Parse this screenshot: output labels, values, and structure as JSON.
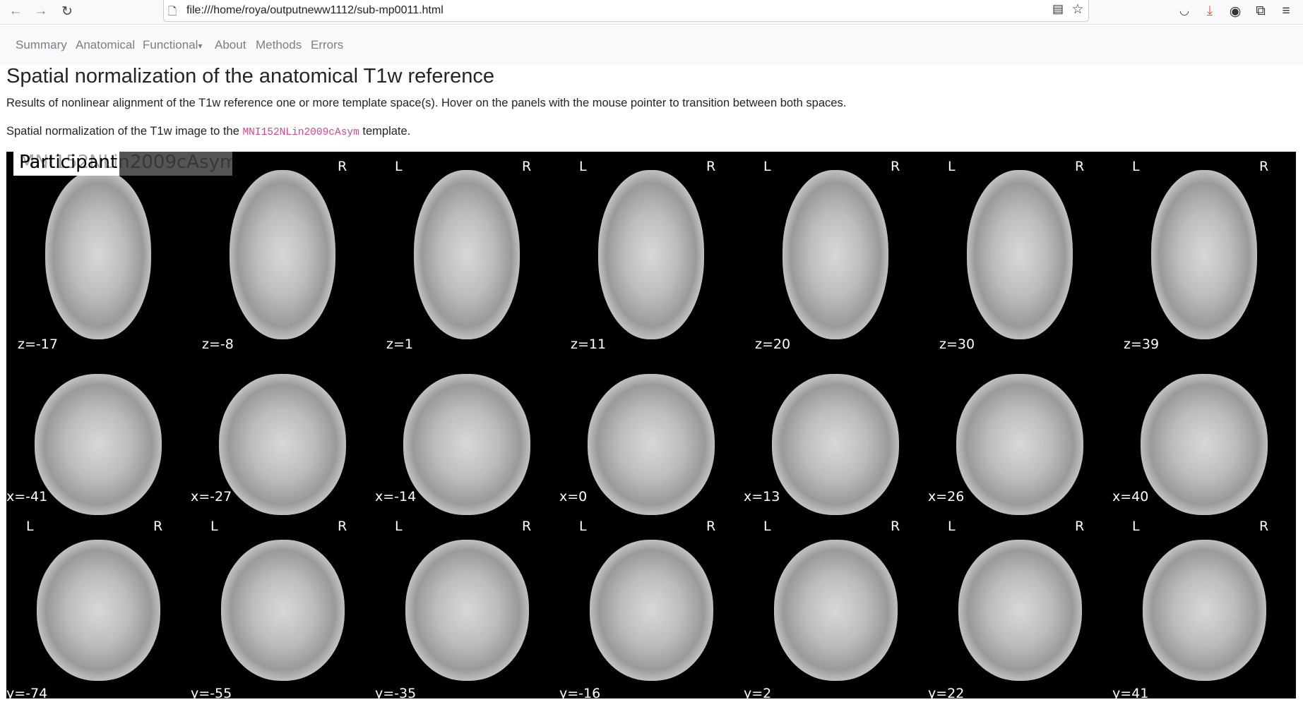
{
  "browser": {
    "url": "file:///home/roya/outputneww1112/sub-mp0011.html",
    "accent": "#e8572b"
  },
  "nav": {
    "items": [
      "Summary",
      "Anatomical",
      "Functional",
      "About",
      "Methods",
      "Errors"
    ],
    "dropdown_caret": "▾"
  },
  "title": "Spatial normalization of the anatomical T1w reference",
  "description": "Results of nonlinear alignment of the T1w reference one or more template space(s). Hover on the panels with the mouse pointer to transition between both spaces.",
  "caption": {
    "prefix": "Spatial normalization of the T1w image to the ",
    "template": "MNI152NLin2009cAsym",
    "suffix": " template."
  },
  "figure": {
    "overlay_labels": [
      "Participant",
      "MNI152NLin2009cAsym"
    ],
    "orientation": {
      "left": "L",
      "right": "R"
    },
    "axial": [
      "z=-17",
      "z=-8",
      "z=1",
      "z=11",
      "z=20",
      "z=30",
      "z=39"
    ],
    "sagittal": [
      "x=-41",
      "x=-27",
      "x=-14",
      "x=0",
      "x=13",
      "x=26",
      "x=40"
    ],
    "coronal": [
      "y=-74",
      "y=-55",
      "y=-35",
      "y=-16",
      "y=2",
      "y=22",
      "y=41"
    ]
  }
}
